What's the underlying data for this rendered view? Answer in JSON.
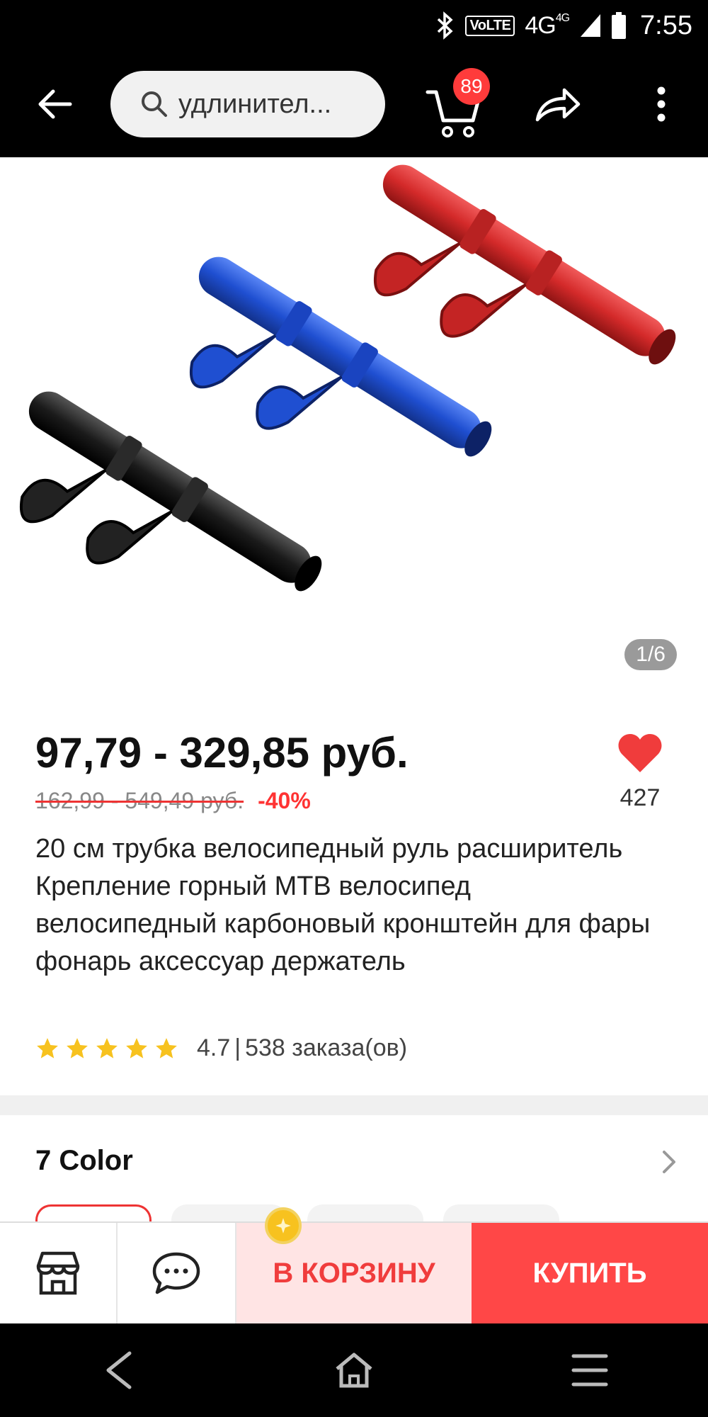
{
  "status_bar": {
    "bluetooth_icon": "bluetooth-icon",
    "volte": "VoLTE",
    "network": "4G",
    "network_small": "4G",
    "time": "7:55"
  },
  "app_bar": {
    "search_text": "удлинител...",
    "cart_count": "89"
  },
  "product": {
    "image_page": "1/6",
    "price": "97,79 - 329,85 руб.",
    "old_price": "162,99 - 549,49 руб.",
    "discount": "-40%",
    "wishlist_count": "427",
    "title": "20 см трубка велосипедный руль расширитель Крепление горный МТВ велосипед велосипедный карбоновый кронштейн для фары фонарь аксессуар держатель",
    "rating": "4.7",
    "orders": "538 заказа(ов)",
    "rating_separator": "|",
    "stars": 5,
    "tube_colors": [
      "#d42a2a",
      "#1f4fd1",
      "#1b1b1b"
    ]
  },
  "color_selector": {
    "title": "7 Color"
  },
  "action_bar": {
    "add_to_cart": "В КОРЗИНУ",
    "buy": "КУПИТЬ"
  },
  "colors": {
    "accent": "#ff4747",
    "accent_light": "#ffe4e4",
    "star": "#f7c21f"
  }
}
